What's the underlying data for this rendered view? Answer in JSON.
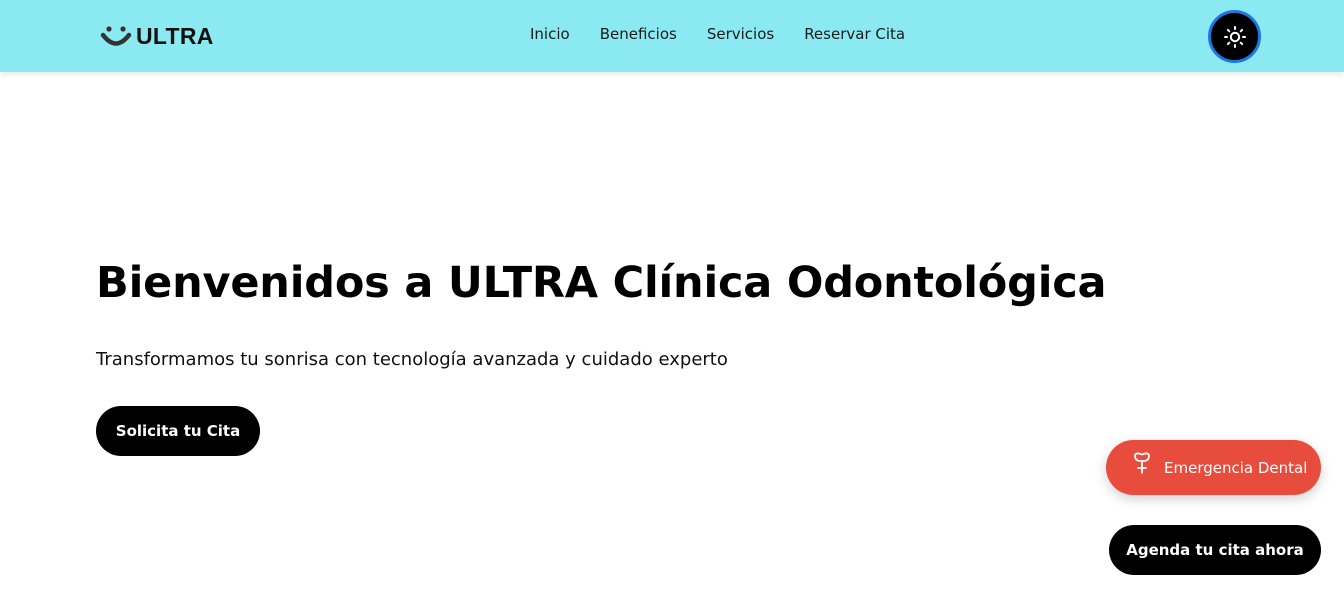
{
  "navbar": {
    "brand": {
      "icon": "smile-icon",
      "name": "ULTRA"
    },
    "links": [
      {
        "label": "Inicio"
      },
      {
        "label": "Beneficios"
      },
      {
        "label": "Servicios"
      },
      {
        "label": "Reservar Cita"
      }
    ],
    "theme_toggle": {
      "icon": "sun-icon"
    }
  },
  "hero": {
    "title": "Bienvenidos a ULTRA Clínica Odontológica",
    "subtitle": "Transformamos tu sonrisa con tecnología avanzada y cuidado experto",
    "cta_label": "Solicita tu Cita"
  },
  "floating": {
    "emergency": {
      "icon": "tooth-icon",
      "label": "Emergencia Dental"
    },
    "agenda_label": "Agenda tu cita ahora"
  },
  "colors": {
    "navbar_bg": "#8be9f2",
    "primary": "#000000",
    "emergency": "#e84c3d",
    "toggle_ring": "#1d78e6"
  }
}
